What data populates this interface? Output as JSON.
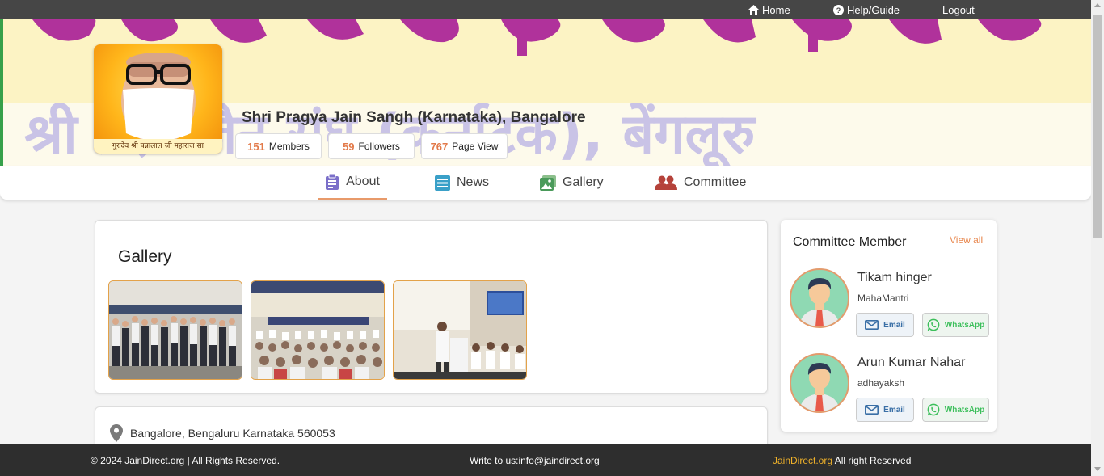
{
  "topnav": {
    "home": "Home",
    "help": "Help/Guide",
    "logout": "Logout"
  },
  "profile": {
    "pic_caption": "गुरुदेव श्री पन्नालाल जी महाराज सा",
    "org_name": "Shri Pragya Jain Sangh (Karnataka), Bangalore",
    "stats": {
      "members_count": "151",
      "members_label": "Members",
      "followers_count": "59",
      "followers_label": "Followers",
      "views_count": "767",
      "views_label": "Page View"
    }
  },
  "cover": {
    "line2_text": "श्री प्रज्ञा जैन संघ (कर्नाटक), बेंगलूरु",
    "colors": {
      "background": "#fcf3c4",
      "line1": "#b0329b",
      "line2": "#c9c3e6"
    }
  },
  "tabs": [
    {
      "label": "About",
      "icon": "clipboard-icon"
    },
    {
      "label": "News",
      "icon": "newspaper-icon"
    },
    {
      "label": "Gallery",
      "icon": "image-icon"
    },
    {
      "label": "Committee",
      "icon": "people-icon"
    }
  ],
  "gallery": {
    "title": "Gallery",
    "thumbnails": [
      {
        "name": "gallery-photo-1"
      },
      {
        "name": "gallery-photo-2"
      },
      {
        "name": "gallery-photo-3"
      }
    ]
  },
  "address": {
    "text": "Bangalore, Bengaluru Karnataka 560053",
    "icon": "location-pin-icon"
  },
  "committee": {
    "title": "Committee Member",
    "view_all": "View all",
    "members": [
      {
        "name": "Tikam hinger",
        "role": "MahaMantri",
        "email_label": "Email",
        "whatsapp_label": "WhatsApp"
      },
      {
        "name": "Arun Kumar Nahar",
        "role": "adhayaksh",
        "email_label": "Email",
        "whatsapp_label": "WhatsApp"
      }
    ]
  },
  "footer": {
    "copyright": "© 2024 JainDirect.org | All Rights Reserved.",
    "contact": "Write to us:info@jaindirect.org",
    "brand": "JainDirect.org",
    "rights": " All right Reserved"
  },
  "colors": {
    "accent": "#e27a4a",
    "topbar": "#464646",
    "footer": "#2e2e2e",
    "brand_yellow": "#f0b22a",
    "whatsapp_green": "#3cbf5b",
    "email_blue": "#3a6fa6"
  }
}
